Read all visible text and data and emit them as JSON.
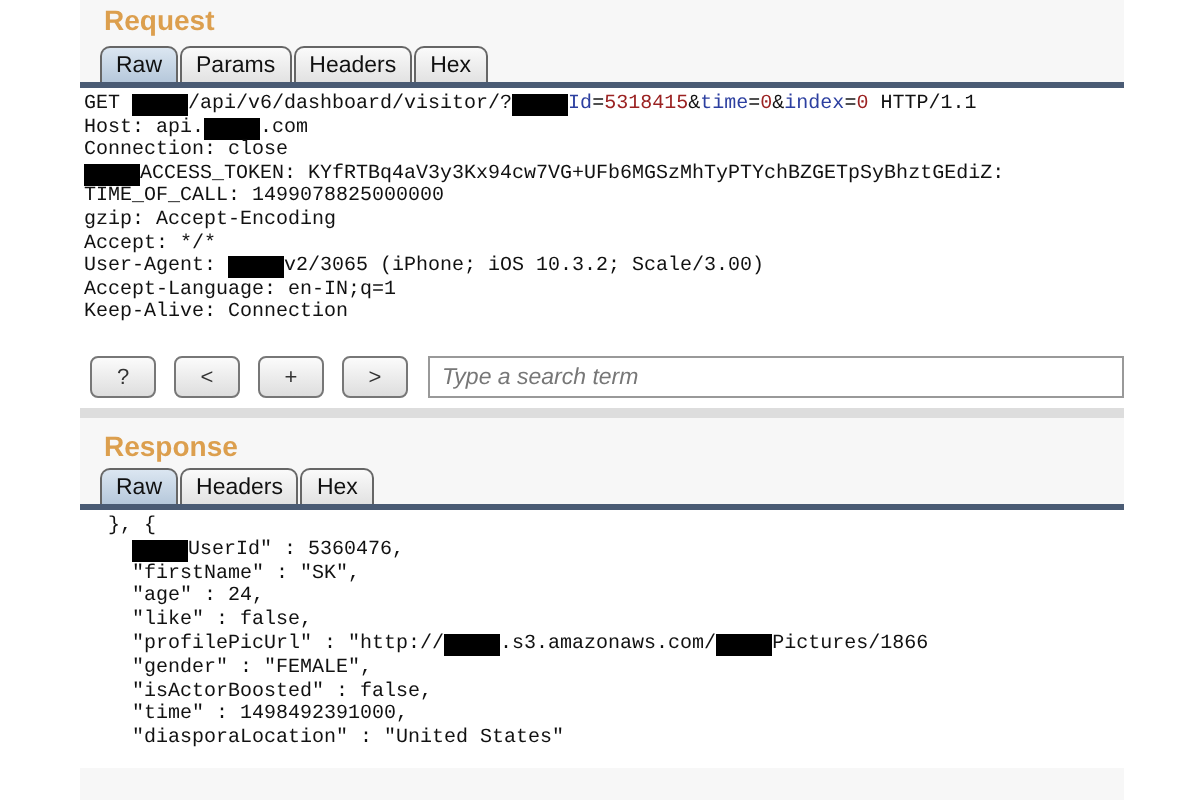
{
  "request": {
    "title": "Request",
    "tabs": [
      {
        "label": "Raw",
        "selected": true
      },
      {
        "label": "Params",
        "selected": false
      },
      {
        "label": "Headers",
        "selected": false
      },
      {
        "label": "Hex",
        "selected": false
      }
    ],
    "lines": [
      [
        {
          "kind": "text",
          "text": "GET "
        },
        {
          "kind": "redacted"
        },
        {
          "kind": "text",
          "text": "/api/v6/dashboard/visitor/?"
        },
        {
          "kind": "redacted"
        },
        {
          "kind": "key",
          "text": "Id"
        },
        {
          "kind": "text",
          "text": "="
        },
        {
          "kind": "value",
          "text": "5318415"
        },
        {
          "kind": "text",
          "text": "&"
        },
        {
          "kind": "key",
          "text": "time"
        },
        {
          "kind": "text",
          "text": "="
        },
        {
          "kind": "value",
          "text": "0"
        },
        {
          "kind": "text",
          "text": "&"
        },
        {
          "kind": "key",
          "text": "index"
        },
        {
          "kind": "text",
          "text": "="
        },
        {
          "kind": "value",
          "text": "0"
        },
        {
          "kind": "text",
          "text": " HTTP/1.1"
        }
      ],
      [
        {
          "kind": "text",
          "text": "Host: api."
        },
        {
          "kind": "redacted"
        },
        {
          "kind": "text",
          "text": ".com"
        }
      ],
      [
        {
          "kind": "text",
          "text": "Connection: close"
        }
      ],
      [
        {
          "kind": "redacted"
        },
        {
          "kind": "text",
          "text": "ACCESS_TOKEN: KYfRTBq4aV3y3Kx94cw7VG+UFb6MGSzMhTyPTYchBZGETpSyBhztGEdiZ:"
        }
      ],
      [
        {
          "kind": "text",
          "text": "TIME_OF_CALL: 1499078825000000"
        }
      ],
      [
        {
          "kind": "text",
          "text": "gzip: Accept-Encoding"
        }
      ],
      [
        {
          "kind": "text",
          "text": "Accept: */*"
        }
      ],
      [
        {
          "kind": "text",
          "text": "User-Agent: "
        },
        {
          "kind": "redacted"
        },
        {
          "kind": "text",
          "text": "v2/3065 (iPhone; iOS 10.3.2; Scale/3.00)"
        }
      ],
      [
        {
          "kind": "text",
          "text": "Accept-Language: en-IN;q=1"
        }
      ],
      [
        {
          "kind": "text",
          "text": "Keep-Alive: Connection"
        }
      ]
    ]
  },
  "toolbar": {
    "buttons": [
      "?",
      "<",
      "+",
      ">"
    ],
    "search": {
      "placeholder": "Type a search term"
    }
  },
  "response": {
    "title": "Response",
    "tabs": [
      {
        "label": "Raw",
        "selected": true
      },
      {
        "label": "Headers",
        "selected": false
      },
      {
        "label": "Hex",
        "selected": false
      }
    ],
    "lines": [
      {
        "kind": "bracket",
        "parts": [
          {
            "kind": "text",
            "text": "}, {"
          }
        ]
      },
      {
        "kind": "field",
        "parts": [
          {
            "kind": "redacted"
          },
          {
            "kind": "text",
            "text": "UserId\" : 5360476,"
          }
        ]
      },
      {
        "kind": "field",
        "parts": [
          {
            "kind": "text",
            "text": "\"firstName\" : \"SK\","
          }
        ]
      },
      {
        "kind": "field",
        "parts": [
          {
            "kind": "text",
            "text": "\"age\" : 24,"
          }
        ]
      },
      {
        "kind": "field",
        "parts": [
          {
            "kind": "text",
            "text": "\"like\" : false,"
          }
        ]
      },
      {
        "kind": "field",
        "parts": [
          {
            "kind": "text",
            "text": "\"profilePicUrl\" : \"http://"
          },
          {
            "kind": "redacted"
          },
          {
            "kind": "text",
            "text": ".s3.amazonaws.com/"
          },
          {
            "kind": "redacted"
          },
          {
            "kind": "text",
            "text": "Pictures/1866"
          }
        ]
      },
      {
        "kind": "field",
        "parts": [
          {
            "kind": "text",
            "text": "\"gender\" : \"FEMALE\","
          }
        ]
      },
      {
        "kind": "field",
        "parts": [
          {
            "kind": "text",
            "text": "\"isActorBoosted\" : false,"
          }
        ]
      },
      {
        "kind": "field",
        "parts": [
          {
            "kind": "text",
            "text": "\"time\" : 1498492391000,"
          }
        ]
      },
      {
        "kind": "field",
        "parts": [
          {
            "kind": "text",
            "text": "\"diasporaLocation\" : \"United States\""
          }
        ]
      }
    ]
  }
}
